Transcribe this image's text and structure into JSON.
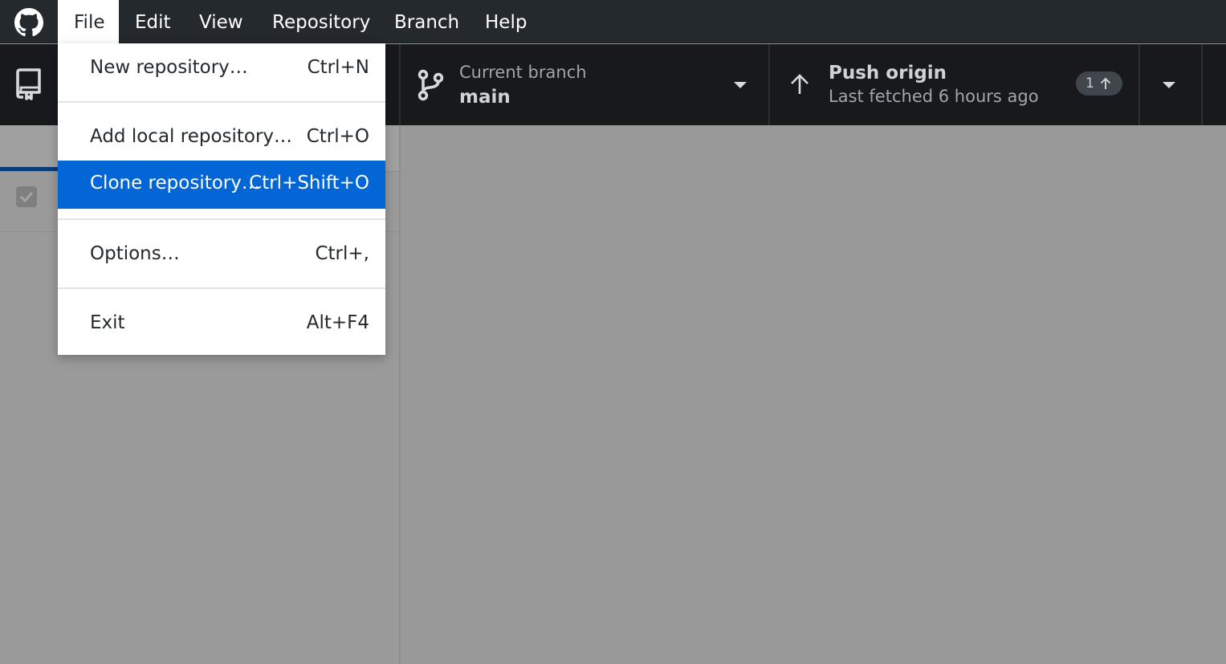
{
  "menubar": {
    "items": [
      {
        "label": "File"
      },
      {
        "label": "Edit"
      },
      {
        "label": "View"
      },
      {
        "label": "Repository"
      },
      {
        "label": "Branch"
      },
      {
        "label": "Help"
      }
    ],
    "open_menu": "File"
  },
  "toolbar": {
    "repository_icon": "repo-icon",
    "branch": {
      "sublabel": "Current branch",
      "name": "main"
    },
    "push": {
      "title": "Push origin",
      "sublabel": "Last fetched 6 hours ago",
      "ahead_count": "1"
    }
  },
  "file_menu": {
    "items": [
      {
        "label": "New repository…",
        "shortcut": "Ctrl+N"
      },
      {
        "label": "Add local repository…",
        "shortcut": "Ctrl+O"
      },
      {
        "label": "Clone repository…",
        "shortcut": "Ctrl+Shift+O",
        "highlighted": true
      },
      {
        "label": "Options…",
        "shortcut": "Ctrl+,"
      },
      {
        "label": "Exit",
        "shortcut": "Alt+F4"
      }
    ]
  },
  "colors": {
    "menubar_bg": "#24292e",
    "toolbar_bg": "#17191c",
    "highlight": "#0366d6",
    "overlay": "#999999"
  }
}
